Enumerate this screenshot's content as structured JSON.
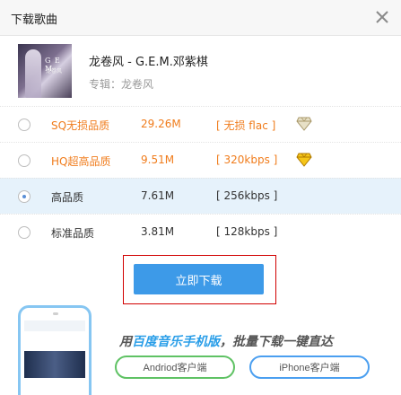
{
  "window": {
    "title": "下载歌曲"
  },
  "song": {
    "name": "龙卷风 - G.E.M.邓紫棋",
    "album": "专辑：龙卷风",
    "cover_text": "G E M",
    "cover_subtext": "龙卷风"
  },
  "qualities": [
    {
      "name": "SQ无损品质",
      "size": "29.26M",
      "format": "[ 无损 flac ]",
      "color": "#f07c1c",
      "badge": "gem-icon-silver",
      "selected": false
    },
    {
      "name": "HQ超高品质",
      "size": "9.51M",
      "format": "[ 320kbps ]",
      "color": "#f07c1c",
      "badge": "gem-icon-gold",
      "selected": false
    },
    {
      "name": "高品质",
      "size": "7.61M",
      "format": "[ 256kbps ]",
      "color": "#333333",
      "badge": "",
      "selected": true
    },
    {
      "name": "标准品质",
      "size": "3.81M",
      "format": "[ 128kbps ]",
      "color": "#333333",
      "badge": "",
      "selected": false
    }
  ],
  "download_button": "立即下载",
  "promo": {
    "text_prefix": "用",
    "text_highlight": "百度音乐手机版",
    "text_suffix": "，批量下载一键直达",
    "android_button": "Andriod客户端",
    "iphone_button": "iPhone客户端"
  },
  "colors": {
    "accent": "#3d9ae8",
    "orange": "#f07c1c",
    "selected_row": "#e6f2fb",
    "highlight_frame": "#d10000"
  }
}
